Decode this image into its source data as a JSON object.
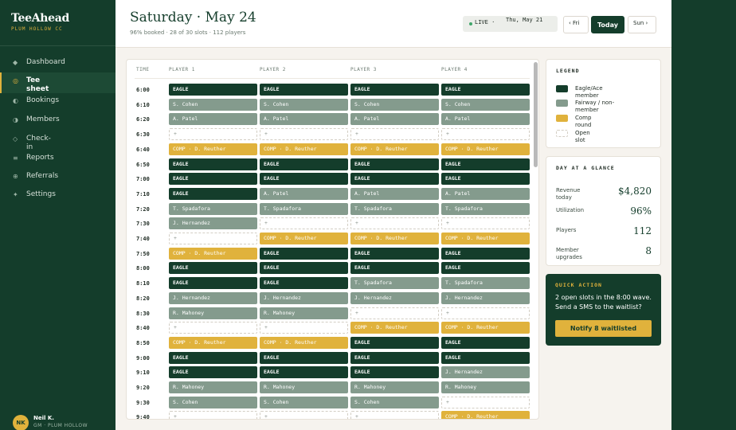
{
  "brand": {
    "name": "TeeAhead",
    "club": "PLUM HOLLOW CC"
  },
  "nav": [
    {
      "icon": "◆",
      "label": "Dashboard"
    },
    {
      "icon": "◎",
      "label": "Tee sheet"
    },
    {
      "icon": "◐",
      "label": "Bookings"
    },
    {
      "icon": "◑",
      "label": "Members"
    },
    {
      "icon": "◇",
      "label": "Check-in"
    },
    {
      "icon": "≡",
      "label": "Reports"
    },
    {
      "icon": "⊕",
      "label": "Referrals"
    },
    {
      "icon": "✦",
      "label": "Settings"
    }
  ],
  "user": {
    "initials": "NK",
    "name": "Neil K.",
    "role": "GM · PLUM HOLLOW"
  },
  "header": {
    "title": "Saturday · May 24",
    "subtitle": "96% booked · 28 of 30 slots · 112 players",
    "live_label": "LIVE ·",
    "live_date": "Thu, May 21",
    "prev_label": "‹ Fri",
    "today_label": "Today",
    "next_label": "Sun ›"
  },
  "grid": {
    "columns": [
      "TIME",
      "PLAYER 1",
      "PLAYER 2",
      "PLAYER 3",
      "PLAYER 4"
    ],
    "rows": [
      {
        "time": "6:00",
        "slots": [
          [
            "eagle",
            "EAGLE"
          ],
          [
            "eagle",
            "EAGLE"
          ],
          [
            "eagle",
            "EAGLE"
          ],
          [
            "eagle",
            "EAGLE"
          ]
        ]
      },
      {
        "time": "6:10",
        "slots": [
          [
            "fairway",
            "S. Cohen"
          ],
          [
            "fairway",
            "S. Cohen"
          ],
          [
            "fairway",
            "S. Cohen"
          ],
          [
            "fairway",
            "S. Cohen"
          ]
        ]
      },
      {
        "time": "6:20",
        "slots": [
          [
            "fairway",
            "A. Patel"
          ],
          [
            "fairway",
            "A. Patel"
          ],
          [
            "fairway",
            "A. Patel"
          ],
          [
            "fairway",
            "A. Patel"
          ]
        ]
      },
      {
        "time": "6:30",
        "slots": [
          [
            "open",
            "+"
          ],
          [
            "open",
            "+"
          ],
          [
            "open",
            "+"
          ],
          [
            "open",
            "+"
          ]
        ]
      },
      {
        "time": "6:40",
        "slots": [
          [
            "comp",
            "COMP · D. Reuther"
          ],
          [
            "comp",
            "COMP · D. Reuther"
          ],
          [
            "comp",
            "COMP · D. Reuther"
          ],
          [
            "comp",
            "COMP · D. Reuther"
          ]
        ]
      },
      {
        "time": "6:50",
        "slots": [
          [
            "eagle",
            "EAGLE"
          ],
          [
            "eagle",
            "EAGLE"
          ],
          [
            "eagle",
            "EAGLE"
          ],
          [
            "eagle",
            "EAGLE"
          ]
        ]
      },
      {
        "time": "7:00",
        "slots": [
          [
            "eagle",
            "EAGLE"
          ],
          [
            "eagle",
            "EAGLE"
          ],
          [
            "eagle",
            "EAGLE"
          ],
          [
            "eagle",
            "EAGLE"
          ]
        ]
      },
      {
        "time": "7:10",
        "slots": [
          [
            "eagle",
            "EAGLE"
          ],
          [
            "fairway",
            "A. Patel"
          ],
          [
            "fairway",
            "A. Patel"
          ],
          [
            "fairway",
            "A. Patel"
          ]
        ]
      },
      {
        "time": "7:20",
        "slots": [
          [
            "fairway",
            "T. Spadafora"
          ],
          [
            "fairway",
            "T. Spadafora"
          ],
          [
            "fairway",
            "T. Spadafora"
          ],
          [
            "fairway",
            "T. Spadafora"
          ]
        ]
      },
      {
        "time": "7:30",
        "slots": [
          [
            "fairway",
            "J. Hernandez"
          ],
          [
            "open",
            "+"
          ],
          [
            "open",
            "+"
          ],
          [
            "open",
            "+"
          ]
        ]
      },
      {
        "time": "7:40",
        "slots": [
          [
            "open",
            "+"
          ],
          [
            "comp",
            "COMP · D. Reuther"
          ],
          [
            "comp",
            "COMP · D. Reuther"
          ],
          [
            "comp",
            "COMP · D. Reuther"
          ]
        ]
      },
      {
        "time": "7:50",
        "slots": [
          [
            "comp",
            "COMP · D. Reuther"
          ],
          [
            "eagle",
            "EAGLE"
          ],
          [
            "eagle",
            "EAGLE"
          ],
          [
            "eagle",
            "EAGLE"
          ]
        ]
      },
      {
        "time": "8:00",
        "slots": [
          [
            "eagle",
            "EAGLE"
          ],
          [
            "eagle",
            "EAGLE"
          ],
          [
            "eagle",
            "EAGLE"
          ],
          [
            "eagle",
            "EAGLE"
          ]
        ]
      },
      {
        "time": "8:10",
        "slots": [
          [
            "eagle",
            "EAGLE"
          ],
          [
            "eagle",
            "EAGLE"
          ],
          [
            "fairway",
            "T. Spadafora"
          ],
          [
            "fairway",
            "T. Spadafora"
          ]
        ]
      },
      {
        "time": "8:20",
        "slots": [
          [
            "fairway",
            "J. Hernandez"
          ],
          [
            "fairway",
            "J. Hernandez"
          ],
          [
            "fairway",
            "J. Hernandez"
          ],
          [
            "fairway",
            "J. Hernandez"
          ]
        ]
      },
      {
        "time": "8:30",
        "slots": [
          [
            "fairway",
            "R. Mahoney"
          ],
          [
            "fairway",
            "R. Mahoney"
          ],
          [
            "open",
            "+"
          ],
          [
            "open",
            "+"
          ]
        ]
      },
      {
        "time": "8:40",
        "slots": [
          [
            "open",
            "+"
          ],
          [
            "open",
            "+"
          ],
          [
            "comp",
            "COMP · D. Reuther"
          ],
          [
            "comp",
            "COMP · D. Reuther"
          ]
        ]
      },
      {
        "time": "8:50",
        "slots": [
          [
            "comp",
            "COMP · D. Reuther"
          ],
          [
            "comp",
            "COMP · D. Reuther"
          ],
          [
            "eagle",
            "EAGLE"
          ],
          [
            "eagle",
            "EAGLE"
          ]
        ]
      },
      {
        "time": "9:00",
        "slots": [
          [
            "eagle",
            "EAGLE"
          ],
          [
            "eagle",
            "EAGLE"
          ],
          [
            "eagle",
            "EAGLE"
          ],
          [
            "eagle",
            "EAGLE"
          ]
        ]
      },
      {
        "time": "9:10",
        "slots": [
          [
            "eagle",
            "EAGLE"
          ],
          [
            "eagle",
            "EAGLE"
          ],
          [
            "eagle",
            "EAGLE"
          ],
          [
            "fairway",
            "J. Hernandez"
          ]
        ]
      },
      {
        "time": "9:20",
        "slots": [
          [
            "fairway",
            "R. Mahoney"
          ],
          [
            "fairway",
            "R. Mahoney"
          ],
          [
            "fairway",
            "R. Mahoney"
          ],
          [
            "fairway",
            "R. Mahoney"
          ]
        ]
      },
      {
        "time": "9:30",
        "slots": [
          [
            "fairway",
            "S. Cohen"
          ],
          [
            "fairway",
            "S. Cohen"
          ],
          [
            "fairway",
            "S. Cohen"
          ],
          [
            "open",
            "+"
          ]
        ]
      },
      {
        "time": "9:40",
        "slots": [
          [
            "open",
            "+"
          ],
          [
            "open",
            "+"
          ],
          [
            "open",
            "+"
          ],
          [
            "comp",
            "COMP · D. Reuther"
          ]
        ]
      }
    ]
  },
  "legend": {
    "title": "LEGEND",
    "items": [
      {
        "label": "Eagle/Ace member",
        "color": "#143d2b",
        "kind": "eagle"
      },
      {
        "label": "Fairway / non-member",
        "color": "#849b8d",
        "kind": "fairway"
      },
      {
        "label": "Comp round",
        "color": "#e0b23c",
        "kind": "comp"
      },
      {
        "label": "Open slot",
        "color": "#ffffff",
        "kind": "open"
      }
    ]
  },
  "glance": {
    "title": "DAY AT A GLANCE",
    "stats": [
      {
        "label": "Revenue today",
        "value": "$4,820"
      },
      {
        "label": "Utilization",
        "value": "96%"
      },
      {
        "label": "Players",
        "value": "112"
      },
      {
        "label": "Member upgrades",
        "value": "8"
      }
    ]
  },
  "quick_action": {
    "title": "QUICK ACTION",
    "text": "2 open slots in the 8:00 wave. Send a SMS to the waitlist?",
    "button": "Notify 8 waitlisted"
  },
  "colors": {
    "brand_green": "#143d2b",
    "gold": "#e0b23c",
    "fairway": "#849b8d",
    "background": "#f6f3ee"
  }
}
